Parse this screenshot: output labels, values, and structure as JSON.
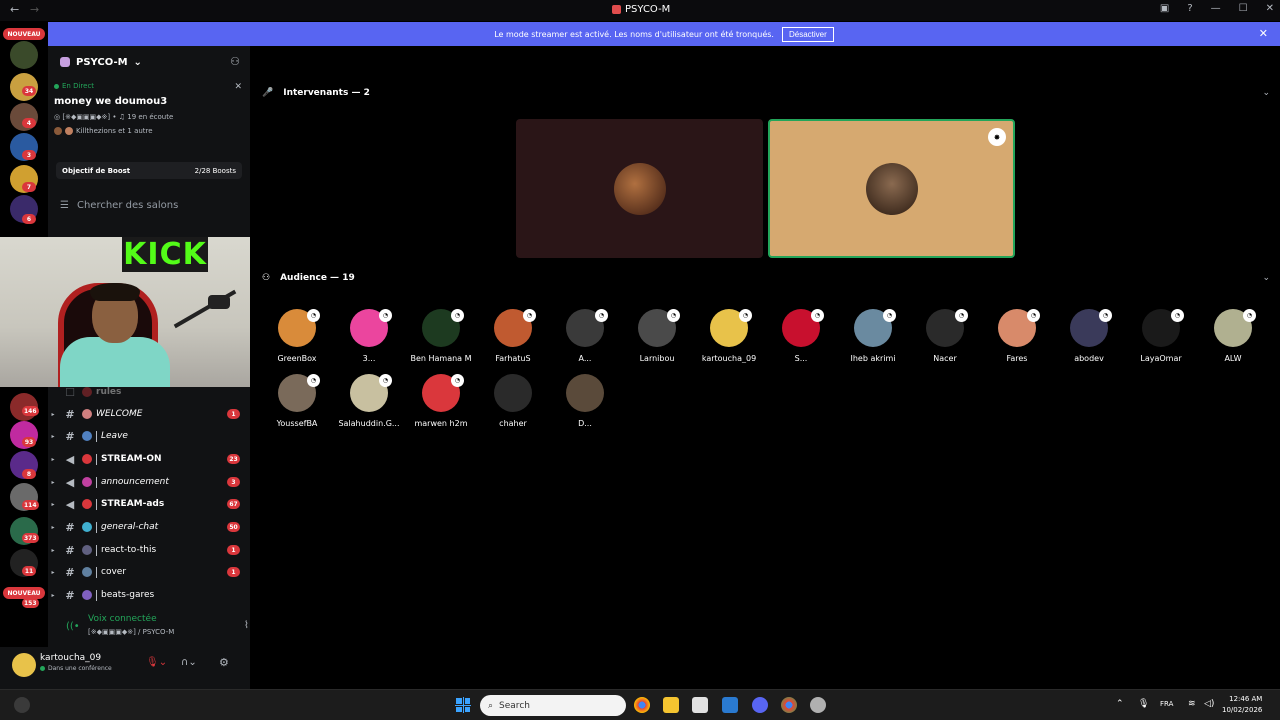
{
  "window": {
    "title": "PSYCO-M"
  },
  "banner": {
    "text": "Le mode streamer est activé. Les noms d'utilisateur ont été tronqués.",
    "button": "Désactiver"
  },
  "rail": {
    "new_label": "NOUVEAU",
    "badges": [
      "34",
      "4",
      "3",
      "7",
      "6",
      "146",
      "93",
      "8",
      "114",
      "373",
      "11",
      "153"
    ]
  },
  "server": {
    "name": "PSYCO-M",
    "caret": "⌄"
  },
  "live": {
    "tag": "En Direct",
    "title": "money we doumou3",
    "channel": "[※◆▣▣▣◆※]",
    "listeners": "19 en écoute",
    "users": "Killthezions et 1 autre"
  },
  "boost": {
    "label": "Objectif de Boost",
    "value": "2/28 Boosts"
  },
  "search_channels": "Chercher des salons",
  "webcam": {
    "logo_text": "KICK"
  },
  "channels": [
    {
      "name": "rules",
      "type": "text",
      "style": "normal",
      "count": ""
    },
    {
      "name": "WELCOME",
      "type": "text",
      "style": "italic",
      "count": "1"
    },
    {
      "name": "Leave",
      "type": "text",
      "style": "italic",
      "count": ""
    },
    {
      "name": "STREAM-ON",
      "type": "announce",
      "style": "bold",
      "count": "23"
    },
    {
      "name": "announcement",
      "type": "announce",
      "style": "italic",
      "count": "3"
    },
    {
      "name": "STREAM-ads",
      "type": "announce",
      "style": "bold",
      "count": "67"
    },
    {
      "name": "general-chat",
      "type": "text",
      "style": "italic",
      "count": "50"
    },
    {
      "name": "react-to-this",
      "type": "text",
      "style": "normal",
      "count": "1"
    },
    {
      "name": "cover",
      "type": "text",
      "style": "normal",
      "count": "1"
    },
    {
      "name": "beats-gares",
      "type": "text",
      "style": "normal",
      "count": ""
    }
  ],
  "voice": {
    "title": "Voix connectée",
    "subtitle": "[※◆▣▣▣◆※] / PSYCO-M"
  },
  "user": {
    "name": "kartoucha_09",
    "status": "Dans une conférence"
  },
  "stage": {
    "speakers_label": "Intervenants — 2",
    "audience_label": "Audience — 19",
    "speakers": [
      {
        "bg": "#2a1517",
        "avatar": "#5a2a20",
        "active": false
      },
      {
        "bg": "#d6a970",
        "avatar": "#3a2a20",
        "active": true
      }
    ],
    "audience": [
      {
        "name": "GreenBox",
        "color": "#d98b3a"
      },
      {
        "name": "3...",
        "color": "#eb459e"
      },
      {
        "name": "Ben Hamana M",
        "color": "#1d3a20"
      },
      {
        "name": "FarhatuS",
        "color": "#c05a30"
      },
      {
        "name": "A...",
        "color": "#3a3a3a"
      },
      {
        "name": "Larnibou",
        "color": "#4a4a4a"
      },
      {
        "name": "kartoucha_09",
        "color": "#e8c24a"
      },
      {
        "name": "S...",
        "color": "#c8102e"
      },
      {
        "name": "Iheb akrimi",
        "color": "#6a8aa0"
      },
      {
        "name": "Nacer",
        "color": "#2a2a2a"
      },
      {
        "name": "Fares",
        "color": "#d88a6a"
      },
      {
        "name": "abodev",
        "color": "#3a3a5a"
      },
      {
        "name": "LayaOmar",
        "color": "#1a1a1a"
      },
      {
        "name": "ALW",
        "color": "#b0b090"
      },
      {
        "name": "YoussefBA",
        "color": "#7a6a5a"
      },
      {
        "name": "Salahuddin.G...",
        "color": "#c8c0a0"
      },
      {
        "name": "marwen h2m",
        "color": "#da373c"
      },
      {
        "name": "chaher",
        "color": "#2a2a2a"
      },
      {
        "name": "D...",
        "color": "#5a4a3a"
      }
    ]
  },
  "taskbar": {
    "search_placeholder": "Search",
    "lang": "FRA",
    "time": "12:46 AM",
    "date": "10/02/2026"
  },
  "colors": {
    "accent": "#5865f2",
    "live": "#23a55a",
    "badge": "#da373c",
    "active_border": "#23a55a"
  }
}
